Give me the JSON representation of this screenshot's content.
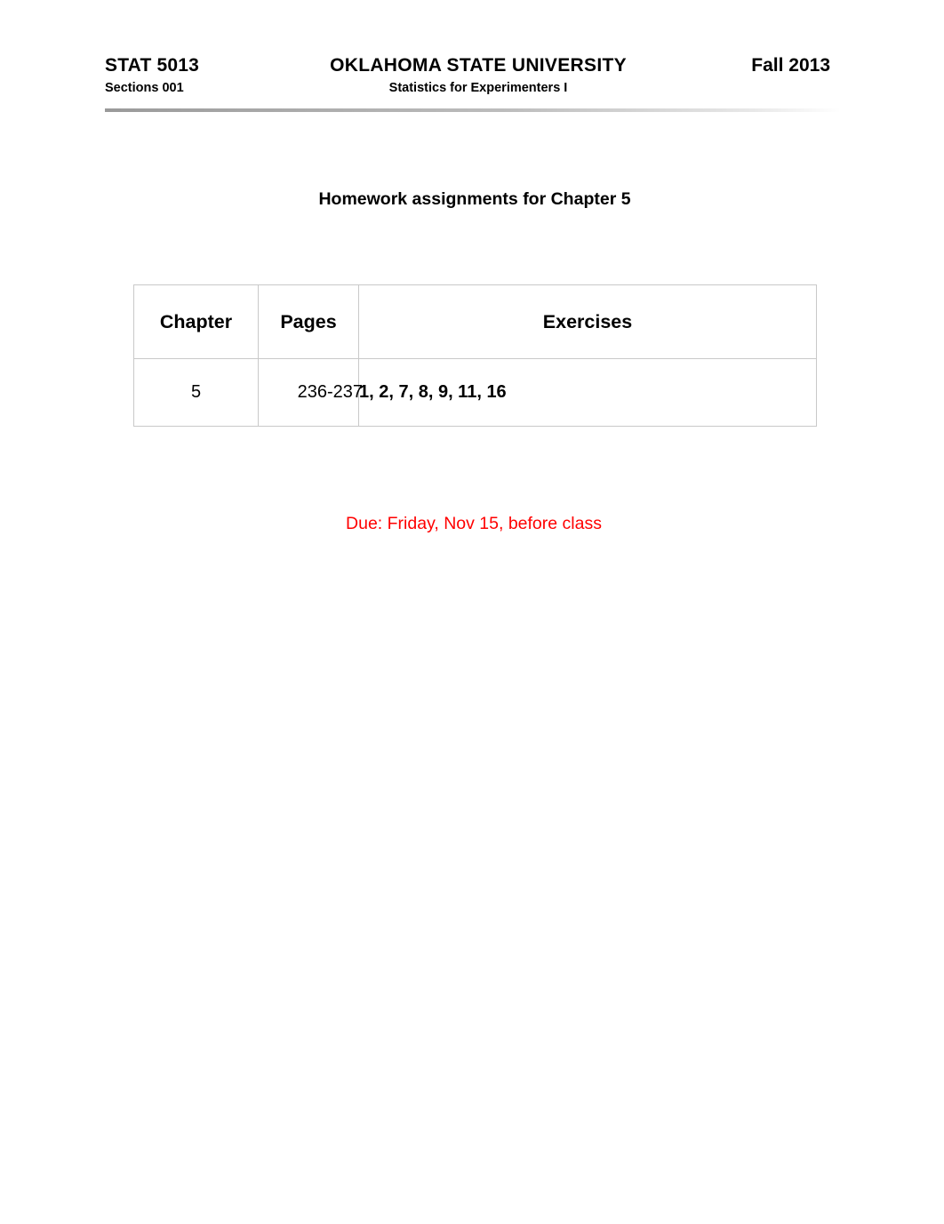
{
  "header": {
    "course_code": "STAT 5013",
    "university": "OKLAHOMA STATE UNIVERSITY",
    "term": "Fall 2013",
    "sections": "Sections 001",
    "subtitle": "Statistics for Experimenters I"
  },
  "page_title": "Homework assignments for Chapter 5",
  "table": {
    "headers": {
      "chapter": "Chapter",
      "pages": "Pages",
      "exercises": "Exercises"
    },
    "rows": [
      {
        "chapter": "5",
        "pages": "236-237",
        "exercises": "1, 2, 7, 8, 9, 11, 16"
      }
    ]
  },
  "due_note": {
    "text": "Due: Friday, Nov 15, before class",
    "color": "#ff0000"
  }
}
